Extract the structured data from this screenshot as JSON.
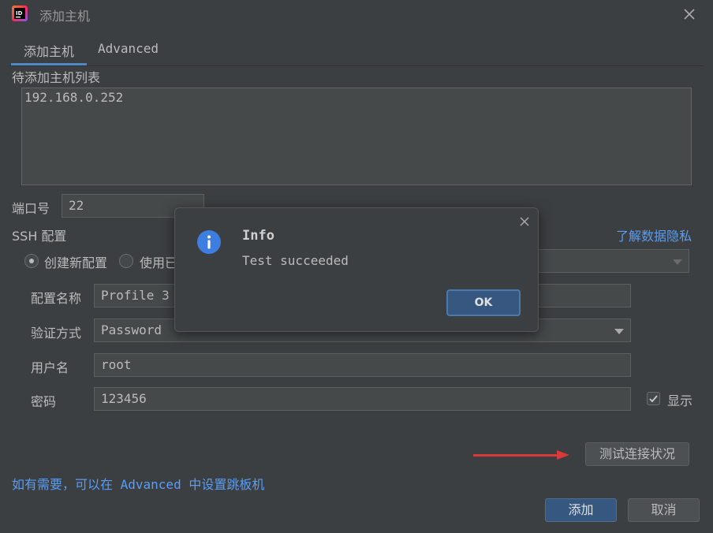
{
  "window": {
    "title": "添加主机"
  },
  "tabs": [
    {
      "label": "添加主机"
    },
    {
      "label": "Advanced"
    }
  ],
  "host_list": {
    "label": "待添加主机列表",
    "value": "192.168.0.252"
  },
  "port": {
    "label": "端口号",
    "value": "22"
  },
  "ssh": {
    "label": "SSH 配置",
    "privacy_link": "了解数据隐私",
    "radio_new": "创建新配置",
    "radio_existing": "使用已"
  },
  "config_name": {
    "label": "配置名称",
    "value": "Profile 3"
  },
  "auth": {
    "label": "验证方式",
    "value": "Password"
  },
  "username": {
    "label": "用户名",
    "value": "root"
  },
  "password": {
    "label": "密码",
    "value": "123456",
    "show_label": "显示"
  },
  "test_button": "测试连接状况",
  "hint_link": "如有需要，可以在 Advanced 中设置跳板机",
  "footer": {
    "add": "添加",
    "cancel": "取消"
  },
  "dialog": {
    "title": "Info",
    "message": "Test succeeded",
    "ok": "OK"
  },
  "colors": {
    "accent": "#365880",
    "link": "#589df6",
    "annotation_arrow": "#d83a3a",
    "info_icon": "#3d7ee0"
  }
}
